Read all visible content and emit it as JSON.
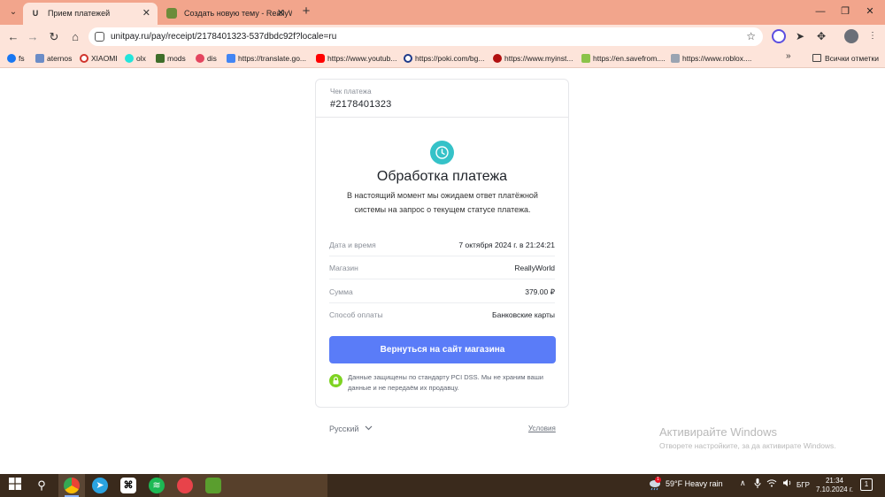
{
  "browser": {
    "tabs": [
      {
        "title": "Прием платежей",
        "icon": "unitpay-icon",
        "active": true
      },
      {
        "title": "Создать новую тему - ReallyW",
        "icon": "reallyworld-icon",
        "active": false
      }
    ],
    "address": {
      "url": "unitpay.ru/pay/receipt/2178401323-537dbdc92f?locale=ru"
    },
    "bookmarks": [
      {
        "label": "fs",
        "icon": "facebook-icon",
        "color": "#1877f2"
      },
      {
        "label": "aternos",
        "icon": "aternos-icon",
        "color": "#6b8cc7"
      },
      {
        "label": "XIAOMI",
        "icon": "xiaomi-icon",
        "color": "#d0342c"
      },
      {
        "label": "olx",
        "icon": "olx-icon",
        "color": "#23e5db"
      },
      {
        "label": "mods",
        "icon": "minecraft-icon",
        "color": "#3f6e2a"
      },
      {
        "label": "dis",
        "icon": "discord-icon",
        "color": "#e4455f"
      },
      {
        "label": "https://translate.go...",
        "icon": "translate-icon",
        "color": "#4285f4"
      },
      {
        "label": "https://www.youtub...",
        "icon": "youtube-icon",
        "color": "#ff0000"
      },
      {
        "label": "https://poki.com/bg...",
        "icon": "poki-icon",
        "color": "#1e3a8a"
      },
      {
        "label": "https://www.myinst...",
        "icon": "myinstants-icon",
        "color": "#b11010"
      },
      {
        "label": "https://en.savefrom....",
        "icon": "savefrom-icon",
        "color": "#8bc34a"
      },
      {
        "label": "https://www.roblox....",
        "icon": "roblox-icon",
        "color": "#9aa4b2"
      }
    ],
    "all_bookmarks": "Всички отметки"
  },
  "receipt": {
    "label": "Чек платежа",
    "number": "#2178401323"
  },
  "status": {
    "title": "Обработка платежа",
    "description": "В настоящий момент мы ожидаем ответ платёжной системы на запрос о текущем статусе платежа."
  },
  "details": [
    {
      "key": "Дата и время",
      "value": "7 октября 2024 г. в 21:24:21"
    },
    {
      "key": "Магазин",
      "value": "ReallyWorld"
    },
    {
      "key": "Сумма",
      "value": "379.00 ₽"
    },
    {
      "key": "Способ оплаты",
      "value": "Банковские карты"
    }
  ],
  "actions": {
    "back_label": "Вернуться на сайт магазина"
  },
  "security": {
    "text": "Данные защищены по стандарту PCI DSS. Мы не храним ваши данные и не передаём их продавцу."
  },
  "footer": {
    "language": "Русский",
    "terms": "Условия"
  },
  "watermark": {
    "title": "Активирайте Windows",
    "subtitle": "Отворете настройките, за да активирате Windows."
  },
  "taskbar": {
    "weather": "59°F  Heavy rain",
    "weather_badge": "1",
    "language": "БГР",
    "time": "21:34",
    "date": "7.10.2024 г.",
    "notifications": "1"
  },
  "colors": {
    "accent": "#5a7cf8",
    "status_icon": "#35c2c8",
    "secure_icon": "#7ed321",
    "chrome_frame": "#f2a58c"
  }
}
